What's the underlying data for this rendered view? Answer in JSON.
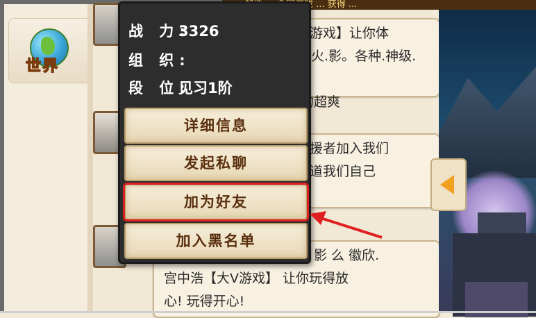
{
  "tab": {
    "label": "世界"
  },
  "banner": {
    "text": "...邮件 ... 金网游戏 ... 获得 ..."
  },
  "popup": {
    "info": [
      {
        "key": "战 力:",
        "value": "3326"
      },
      {
        "key": "组 织:",
        "value": ""
      },
      {
        "key": "段 位:",
        "value": "见习1阶"
      }
    ],
    "buttons": [
      {
        "label": "详细信息"
      },
      {
        "label": "发起私聊"
      },
      {
        "label": "加为好友"
      },
      {
        "label": "加入黑名单"
      }
    ]
  },
  "messages": [
    {
      "lines": [
        "浩【大V游戏】让你体",
        "全新版本 火.影。各种.神级.卡",
        "让你玩的超爽"
      ]
    },
    {
      "lines": [
        "援者加入我们",
        "道我们自己"
      ]
    },
    {
      "lines": [
        "影 么 徽欣.",
        "宫中浩【大V游戏】 让你玩得放",
        "心! 玩得开心!"
      ]
    }
  ],
  "colors": {
    "highlight": "#e02020",
    "arrow": "#e02020",
    "button_text": "#5a2f0e"
  },
  "icons": [
    "globe-icon",
    "collapse-arrow-icon",
    "pointer-arrow-icon",
    "avatar-icon"
  ]
}
